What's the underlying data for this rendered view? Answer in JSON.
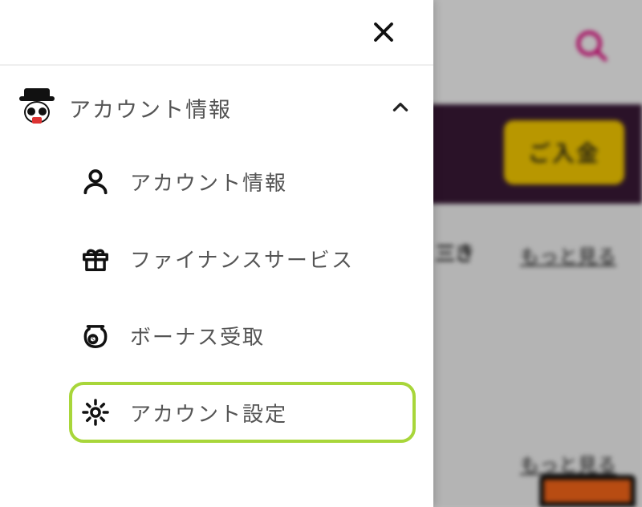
{
  "drawer": {
    "section": {
      "title": "アカウント情報"
    },
    "items": [
      {
        "label": "アカウント情報"
      },
      {
        "label": "ファイナンスサービス"
      },
      {
        "label": "ボーナス受取"
      },
      {
        "label": "アカウント設定"
      }
    ]
  },
  "background": {
    "deposit_button": "ご入金",
    "see_more": "もっと見る"
  },
  "colors": {
    "highlight_border": "#a8d63a",
    "deposit_bg": "#ffd200",
    "band_bg": "#3b1a38",
    "search_icon": "#e6007e"
  }
}
